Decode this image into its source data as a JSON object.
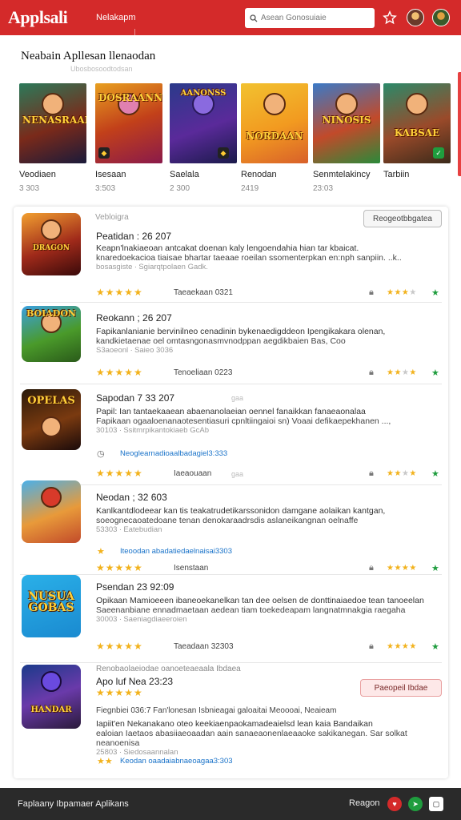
{
  "header": {
    "logo": "Applsali",
    "nav_link": "Nelakapm",
    "search_placeholder": "Asean Gonosuiaie"
  },
  "featured": {
    "title": "Neabain Apllesan llenaodan",
    "subtitle": "Ubosbosoodtodsan",
    "items": [
      {
        "name": "Veodiaen",
        "count": "3 303",
        "art": "NENASRAAE"
      },
      {
        "name": "Isesaan",
        "count": "3:503",
        "art": "DOSRAANN"
      },
      {
        "name": "Saelala",
        "count": "2 300",
        "art": "AANONSS"
      },
      {
        "name": "Renodan",
        "count": "2419",
        "art": "NORDAAN"
      },
      {
        "name": "Senmtelakincy",
        "count": "23:03",
        "art": "NINOSIS"
      },
      {
        "name": "Tarbiin",
        "count": "",
        "art": "KABSAE"
      }
    ]
  },
  "list": {
    "header": "Vebloigra",
    "sort_label": "Reogeotbbgatea",
    "promo_label": "Paeopeil   Ibdae",
    "apps": [
      {
        "title": "Peatidan : 26 207",
        "desc1": "Keapn'lnakiaeoan antcakat doenan kaly lengoendahia hian tar kbaicat.",
        "desc2": "knaredoekacioa tiaisae bhartar taeaae roeilan ssomenterpkan en:nph sanpiin. ..k..",
        "desc3": "bosasgiste ∙ Sgiarqtpolaen Gadk.",
        "downloads": "Taeaekaan 0321",
        "stars": "★★★★★",
        "art": "DRAGON"
      },
      {
        "title": "Reokann ; 26 207",
        "desc1": "Fapikanlanianie bervinilneo cenadinin bykenaedigddeon Ipengikakara olenan,",
        "desc2": "kandkietaenae oel omtasngonasmvnodppan aegdikbaien Bas, Coo",
        "desc3": "S3aoeonl ∙ Saieo 3036",
        "downloads": "Tenoeliaan 0223",
        "stars": "★★★★★",
        "art": "BOIADON"
      },
      {
        "title": "Sapodan 7 33 207",
        "desc1": "Papil: Ian tantaekaaean abaenanolaeian oennel fanaikkan fanaeaonalaa",
        "desc2": "Fapikaan ogaaloenanaotesentiasuri cpnltiingaioi sn) Voaai defikaepekhanen ...,",
        "desc3": "30103 ∙ Ssitmrpikantokiaeb GcAb",
        "link": "Neoglearnadioaalbadagiel3:333",
        "tag": "gaa",
        "downloads": "Iaeaouaan",
        "stars": "★★★★★",
        "art": "OPELAS"
      },
      {
        "title": "Neodan ; 32 603",
        "desc1": "Kanlkantdlodeear kan tis teakatrudetikarssonidon damgane aolaikan kantgan,",
        "desc2": "soeognecaoatedoane tenan denokaraadrsdis aslaneikangnan oelnaffe",
        "desc3": "53303 ∙ Eatebudian",
        "link": "Iteoodan abadatiedaelnaisai3303",
        "downloads": "Isenstaan",
        "stars": "★★★★★",
        "art": "HERO"
      },
      {
        "title": "Psendan 23 92:09",
        "desc1": "Opikaan Mamioeeen ibaneoekanelkan tan dee oelsen de donttinaiaedoe tean tanoeelan",
        "desc2": "Saeenanbiane ennadmaetaan aedean tiam toekedeapam langnatmnakgia raegaha",
        "desc3": "30003 ∙ Saeniagdiaeeroien",
        "downloads": "Taeadaan 32303",
        "stars": "★★★★★",
        "art": "NUSUA GOBAS"
      },
      {
        "pre": "Renobaolaeiodae oanoeteaeaala Ibdaea",
        "title": "Apo luf Nea 23:23",
        "meta": "Fiegnbiei 036:7 Fan'lonesan Isbnieagai galoaitai Meoooai, Neaieam",
        "desc1": "Iapiit'en Nekanakano oteo keekiaenpaokamadeaielsd lean kaia Bandaikan",
        "desc2": "ealoian Iaetaos abasiiaeoaadan aain sanaeaonenlaeaaoke sakikanegan. Sar solkat neanoenisa",
        "desc3": "25803 ∙ Siedosaannalan",
        "link": "Keodan oaadaiabnaeoagaa3:303",
        "stars": "★★★★★",
        "art": "HANDAR"
      }
    ]
  },
  "footer": {
    "copyright": "Faplaany Ibpamaer Aplikans",
    "right_label": "Reagon"
  },
  "colors": {
    "brand": "#d42a2a",
    "star": "#f2b21c",
    "green": "#1f9d3e",
    "link": "#1a73c9"
  }
}
